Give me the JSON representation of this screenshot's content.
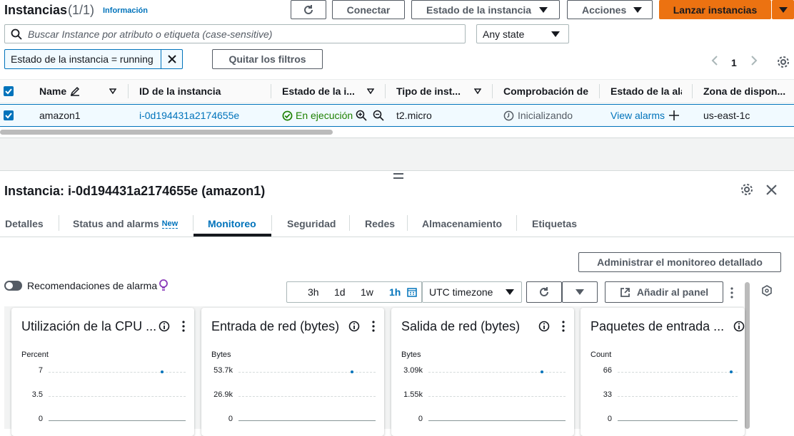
{
  "header": {
    "title": "Instancias",
    "count": "(1/1)",
    "info_link": "Información",
    "connect_label": "Conectar",
    "instance_state_label": "Estado de la instancia",
    "actions_label": "Acciones",
    "launch_label": "Lanzar instancias"
  },
  "search": {
    "placeholder": "Buscar Instance por atributo o etiqueta (case-sensitive)",
    "state_filter": "Any state"
  },
  "filters": {
    "active_filter": "Estado de la instancia = running",
    "clear_label": "Quitar los filtros",
    "page": "1"
  },
  "table": {
    "columns": [
      "Name",
      "ID de la instancia",
      "Estado de la i...",
      "Tipo de inst...",
      "Comprobación de",
      "Estado de la ala",
      "Zona de dispon..."
    ],
    "row": {
      "name": "amazon1",
      "id": "i-0d194431a2174655e",
      "state": "En ejecución",
      "type": "t2.micro",
      "check": "Inicializando",
      "alarms": "View alarms",
      "zone": "us-east-1c"
    }
  },
  "details": {
    "title": "Instancia: i-0d194431a2174655e (amazon1)",
    "tabs": [
      "Detalles",
      "Status and alarms",
      "Monitoreo",
      "Seguridad",
      "Redes",
      "Almacenamiento",
      "Etiquetas"
    ],
    "new_badge": "New",
    "active_tab": "Monitoreo"
  },
  "monitoring": {
    "manage_label": "Administrar el monitoreo detallado",
    "alarm_toggle_label": "Recomendaciones de alarma",
    "time_ranges": [
      "3h",
      "1d",
      "1w",
      "1h"
    ],
    "active_range": "1h",
    "timezone": "UTC timezone",
    "add_panel_label": "Añadir al panel"
  },
  "chart_data": [
    {
      "type": "line",
      "title": "Utilización de la CPU ...",
      "ylabel": "Percent",
      "yticks": [
        "7",
        "3.5",
        "0"
      ],
      "values": [
        7
      ]
    },
    {
      "type": "line",
      "title": "Entrada de red (bytes)",
      "ylabel": "Bytes",
      "yticks": [
        "53.7k",
        "26.9k",
        "0"
      ],
      "values": [
        53700
      ]
    },
    {
      "type": "line",
      "title": "Salida de red (bytes)",
      "ylabel": "Bytes",
      "yticks": [
        "3.09k",
        "1.55k",
        "0"
      ],
      "values": [
        3090
      ]
    },
    {
      "type": "line",
      "title": "Paquetes de entrada ...",
      "ylabel": "Count",
      "yticks": [
        "66",
        "33",
        "0"
      ],
      "values": [
        66
      ]
    }
  ],
  "colors": {
    "accent": "#0073bb",
    "primary_button": "#ec7211",
    "success": "#1d8102"
  }
}
